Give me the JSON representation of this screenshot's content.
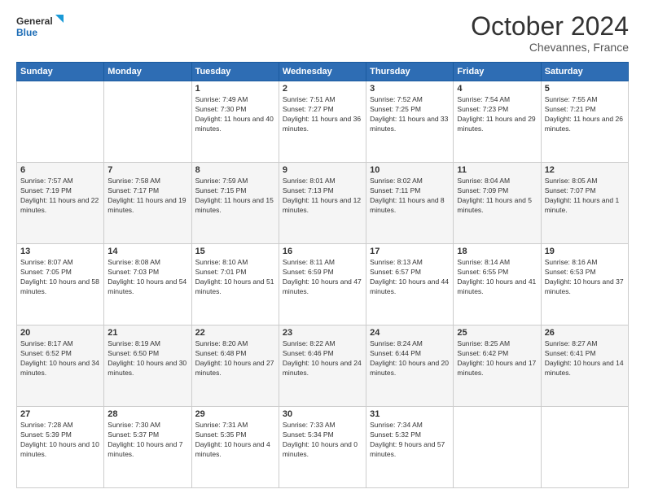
{
  "header": {
    "logo_line1": "General",
    "logo_line2": "Blue",
    "month": "October 2024",
    "location": "Chevannes, France"
  },
  "days_of_week": [
    "Sunday",
    "Monday",
    "Tuesday",
    "Wednesday",
    "Thursday",
    "Friday",
    "Saturday"
  ],
  "weeks": [
    [
      {
        "day": "",
        "info": ""
      },
      {
        "day": "",
        "info": ""
      },
      {
        "day": "1",
        "info": "Sunrise: 7:49 AM\nSunset: 7:30 PM\nDaylight: 11 hours and 40 minutes."
      },
      {
        "day": "2",
        "info": "Sunrise: 7:51 AM\nSunset: 7:27 PM\nDaylight: 11 hours and 36 minutes."
      },
      {
        "day": "3",
        "info": "Sunrise: 7:52 AM\nSunset: 7:25 PM\nDaylight: 11 hours and 33 minutes."
      },
      {
        "day": "4",
        "info": "Sunrise: 7:54 AM\nSunset: 7:23 PM\nDaylight: 11 hours and 29 minutes."
      },
      {
        "day": "5",
        "info": "Sunrise: 7:55 AM\nSunset: 7:21 PM\nDaylight: 11 hours and 26 minutes."
      }
    ],
    [
      {
        "day": "6",
        "info": "Sunrise: 7:57 AM\nSunset: 7:19 PM\nDaylight: 11 hours and 22 minutes."
      },
      {
        "day": "7",
        "info": "Sunrise: 7:58 AM\nSunset: 7:17 PM\nDaylight: 11 hours and 19 minutes."
      },
      {
        "day": "8",
        "info": "Sunrise: 7:59 AM\nSunset: 7:15 PM\nDaylight: 11 hours and 15 minutes."
      },
      {
        "day": "9",
        "info": "Sunrise: 8:01 AM\nSunset: 7:13 PM\nDaylight: 11 hours and 12 minutes."
      },
      {
        "day": "10",
        "info": "Sunrise: 8:02 AM\nSunset: 7:11 PM\nDaylight: 11 hours and 8 minutes."
      },
      {
        "day": "11",
        "info": "Sunrise: 8:04 AM\nSunset: 7:09 PM\nDaylight: 11 hours and 5 minutes."
      },
      {
        "day": "12",
        "info": "Sunrise: 8:05 AM\nSunset: 7:07 PM\nDaylight: 11 hours and 1 minute."
      }
    ],
    [
      {
        "day": "13",
        "info": "Sunrise: 8:07 AM\nSunset: 7:05 PM\nDaylight: 10 hours and 58 minutes."
      },
      {
        "day": "14",
        "info": "Sunrise: 8:08 AM\nSunset: 7:03 PM\nDaylight: 10 hours and 54 minutes."
      },
      {
        "day": "15",
        "info": "Sunrise: 8:10 AM\nSunset: 7:01 PM\nDaylight: 10 hours and 51 minutes."
      },
      {
        "day": "16",
        "info": "Sunrise: 8:11 AM\nSunset: 6:59 PM\nDaylight: 10 hours and 47 minutes."
      },
      {
        "day": "17",
        "info": "Sunrise: 8:13 AM\nSunset: 6:57 PM\nDaylight: 10 hours and 44 minutes."
      },
      {
        "day": "18",
        "info": "Sunrise: 8:14 AM\nSunset: 6:55 PM\nDaylight: 10 hours and 41 minutes."
      },
      {
        "day": "19",
        "info": "Sunrise: 8:16 AM\nSunset: 6:53 PM\nDaylight: 10 hours and 37 minutes."
      }
    ],
    [
      {
        "day": "20",
        "info": "Sunrise: 8:17 AM\nSunset: 6:52 PM\nDaylight: 10 hours and 34 minutes."
      },
      {
        "day": "21",
        "info": "Sunrise: 8:19 AM\nSunset: 6:50 PM\nDaylight: 10 hours and 30 minutes."
      },
      {
        "day": "22",
        "info": "Sunrise: 8:20 AM\nSunset: 6:48 PM\nDaylight: 10 hours and 27 minutes."
      },
      {
        "day": "23",
        "info": "Sunrise: 8:22 AM\nSunset: 6:46 PM\nDaylight: 10 hours and 24 minutes."
      },
      {
        "day": "24",
        "info": "Sunrise: 8:24 AM\nSunset: 6:44 PM\nDaylight: 10 hours and 20 minutes."
      },
      {
        "day": "25",
        "info": "Sunrise: 8:25 AM\nSunset: 6:42 PM\nDaylight: 10 hours and 17 minutes."
      },
      {
        "day": "26",
        "info": "Sunrise: 8:27 AM\nSunset: 6:41 PM\nDaylight: 10 hours and 14 minutes."
      }
    ],
    [
      {
        "day": "27",
        "info": "Sunrise: 7:28 AM\nSunset: 5:39 PM\nDaylight: 10 hours and 10 minutes."
      },
      {
        "day": "28",
        "info": "Sunrise: 7:30 AM\nSunset: 5:37 PM\nDaylight: 10 hours and 7 minutes."
      },
      {
        "day": "29",
        "info": "Sunrise: 7:31 AM\nSunset: 5:35 PM\nDaylight: 10 hours and 4 minutes."
      },
      {
        "day": "30",
        "info": "Sunrise: 7:33 AM\nSunset: 5:34 PM\nDaylight: 10 hours and 0 minutes."
      },
      {
        "day": "31",
        "info": "Sunrise: 7:34 AM\nSunset: 5:32 PM\nDaylight: 9 hours and 57 minutes."
      },
      {
        "day": "",
        "info": ""
      },
      {
        "day": "",
        "info": ""
      }
    ]
  ]
}
